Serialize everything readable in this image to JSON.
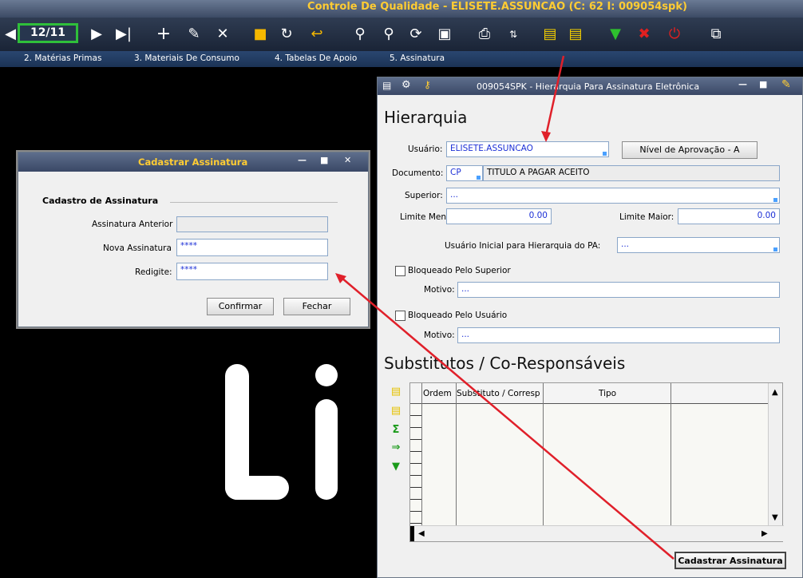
{
  "app": {
    "title": "Controle De Qualidade - ELISETE.ASSUNCAO (C: 62 I: 009054spk)",
    "record_counter": "12/11",
    "menu": [
      "2. Matérias Primas",
      "3. Materiais De Consumo",
      "4. Tabelas De Apoio",
      "5. Assinatura"
    ],
    "toolbar_icons": [
      "prev-icon",
      "next-icon",
      "last-icon",
      "add-icon",
      "edit-icon",
      "delete-icon",
      "save-icon",
      "refresh-icon",
      "undo-icon",
      "filter-icon",
      "zoom-icon",
      "reload-icon",
      "preview-icon",
      "print-icon",
      "sort-icon",
      "insert-line-icon",
      "remove-line-icon",
      "move-down-icon",
      "clear-icon",
      "power-icon",
      "window-icon"
    ]
  },
  "hierarchy_window": {
    "title": "009054SPK - Hierarquia Para Assinatura Eletrônica",
    "heading": "Hierarquia",
    "usuario_label": "Usuário:",
    "usuario_value": "ELISETE.ASSUNCAO",
    "nivel_button": "Nível de Aprovação - A",
    "documento_label": "Documento:",
    "documento_code": "CP",
    "documento_desc": "TITULO A PAGAR ACEITO",
    "superior_label": "Superior:",
    "superior_value": "...",
    "limite_menor_label": "Limite Menor:",
    "limite_menor_value": "0.00",
    "limite_maior_label": "Limite Maior:",
    "limite_maior_value": "0.00",
    "usuario_inicial_label": "Usuário Inicial para Hierarquia do PA:",
    "usuario_inicial_value": "...",
    "bloq_superior_label": "Bloqueado Pelo Superior",
    "motivo1_label": "Motivo:",
    "motivo1_value": "...",
    "bloq_usuario_label": "Bloqueado Pelo Usuário",
    "motivo2_label": "Motivo:",
    "motivo2_value": "...",
    "subs_heading": "Substitutos / Co-Responsáveis",
    "grid_columns": [
      "Ordem",
      "Substituto / Corresp",
      "Tipo"
    ],
    "cadastrar_button": "Cadastrar Assinatura"
  },
  "dialog": {
    "title": "Cadastrar Assinatura",
    "group_label": "Cadastro de  Assinatura",
    "anterior_label": "Assinatura Anterior",
    "anterior_value": "",
    "nova_label": "Nova Assinatura",
    "nova_value": "****",
    "redigite_label": "Redigite:",
    "redigite_value": "****",
    "confirm_button": "Confirmar",
    "close_button": "Fechar"
  },
  "colors": {
    "accent_red": "#e0202a",
    "counter_border": "#2fbf3a",
    "title_yellow": "#ffcc33"
  }
}
